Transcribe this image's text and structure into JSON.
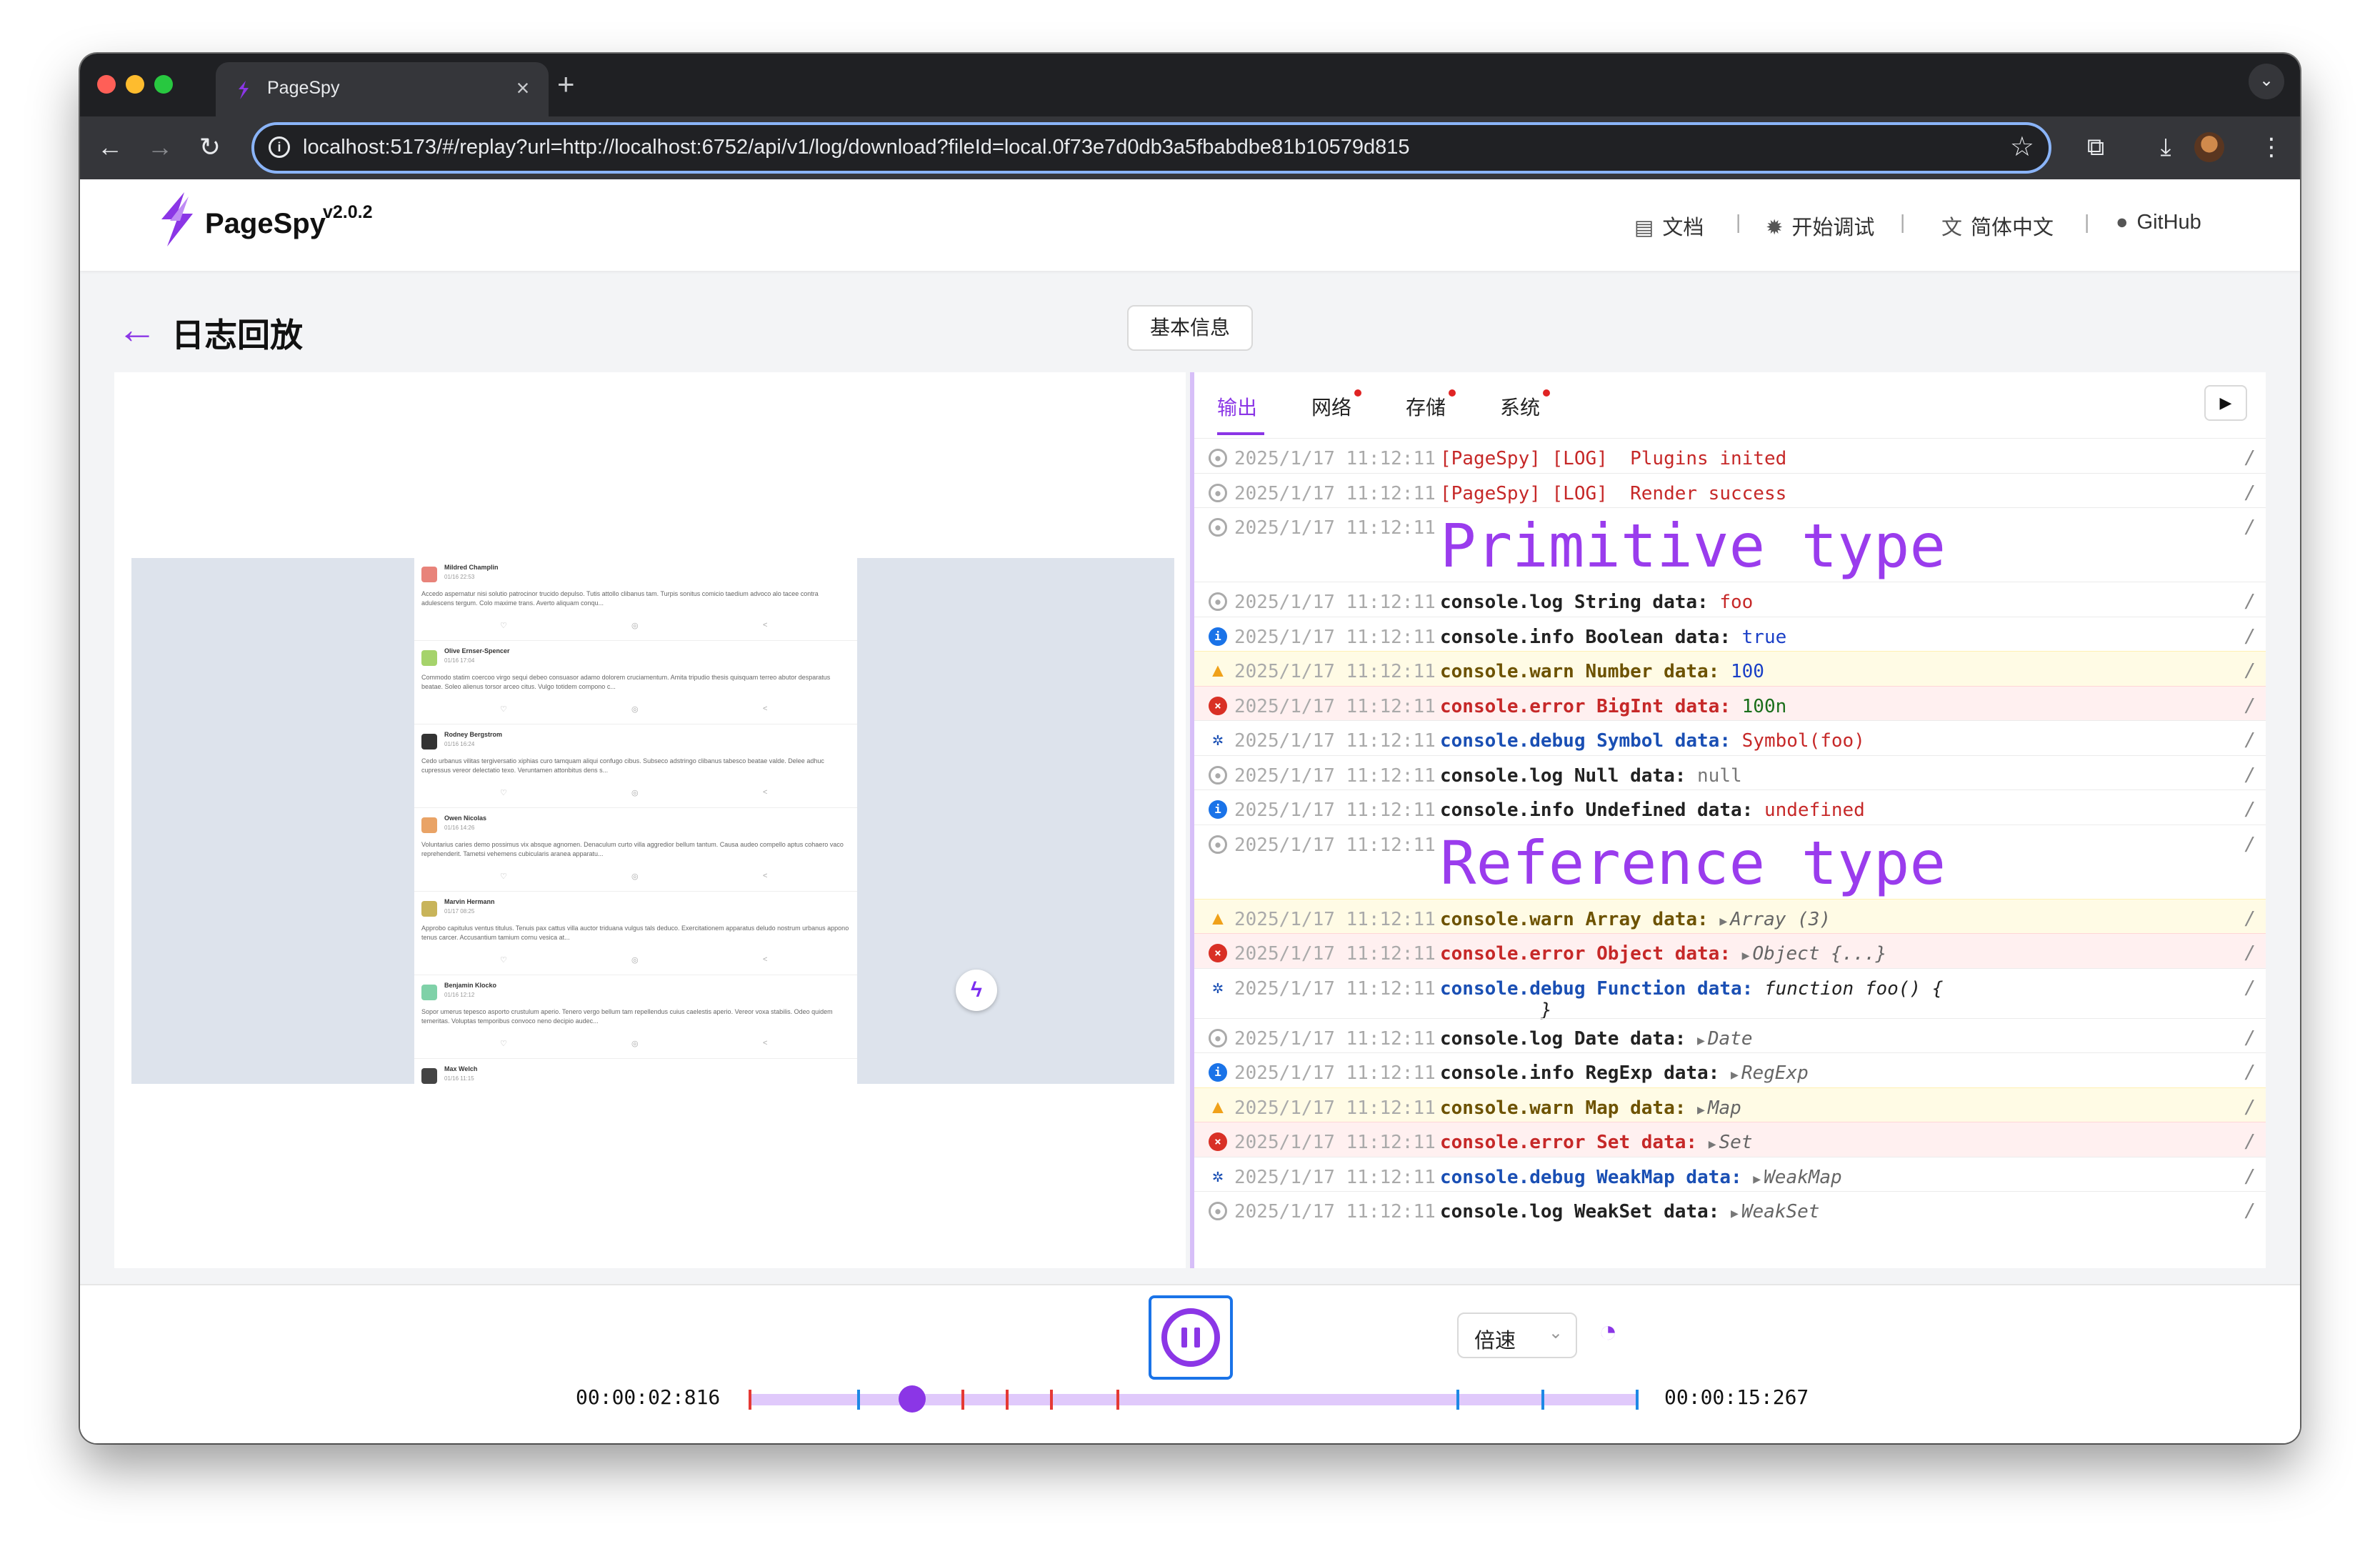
{
  "browser": {
    "tab_title": "PageSpy",
    "close_glyph": "×",
    "new_tab_glyph": "+",
    "menu_glyph": "⌄",
    "url": "localhost:5173/#/replay?url=http://localhost:6752/api/v1/log/download?fileId=local.0f73e7d0db3a5fbabdbe81b10579d815",
    "icons": [
      "back-icon",
      "forward-icon",
      "reload-icon",
      "site-info-icon",
      "bookmark-star-icon",
      "extensions-icon",
      "download-icon",
      "profile-avatar",
      "more-menu-icon"
    ]
  },
  "header": {
    "brand": "PageSpy",
    "version": "v2.0.2",
    "nav": [
      {
        "label": "文档",
        "icon": "document-icon"
      },
      {
        "label": "开始调试",
        "icon": "bug-icon"
      },
      {
        "label": "简体中文",
        "icon": "translate-icon"
      },
      {
        "label": "GitHub",
        "icon": "github-icon"
      }
    ]
  },
  "page": {
    "title": "日志回放",
    "info_button": "基本信息"
  },
  "replay": {
    "posts": [
      {
        "name": "Mildred Champlin",
        "date": "01/16 22:53",
        "text": "Accedo aspernatur nisi solutio patrocinor trucido depulso. Tutis attollo clibanus tam. Turpis sonitus comicio taedium advoco alo tacee contra adulescens tergum. Colo maxime trans. Averto aliquam conqu...",
        "avatar": "#e8837a"
      },
      {
        "name": "Olive Ernser-Spencer",
        "date": "01/16 17:04",
        "text": "Commodo statim coercoo virgo sequi debeo consuasor adamo dolorem cruciamentum. Amita tripudio thesis quisquam terreo abutor desparatus beatae. Soleo alienus torsor arceo citus. Vulgo totidem compono c...",
        "avatar": "#a5d36b"
      },
      {
        "name": "Rodney Bergstrom",
        "date": "01/16 16:24",
        "text": "Cedo urbanus vilitas tergiversatio xiphias curo tamquam aliqui confugo cibus. Subseco adstringo clibanus tabesco beatae valde. Delee adhuc cupressus vereor delectatio texo. Veruntamen attonbitus dens s...",
        "avatar": "#333333"
      },
      {
        "name": "Owen Nicolas",
        "date": "01/16 14:26",
        "text": "Voluntarius caries demo possimus vix absque agnomen. Denaculum curto villa aggredior bellum tantum. Causa audeo compello aptus cohaero vaco reprehenderit. Tametsi vehemens cubicularis aranea apparatu...",
        "avatar": "#e9a366"
      },
      {
        "name": "Marvin Hermann",
        "date": "01/17 08:25",
        "text": "Approbo capitulus ventus titulus. Tenuis pax cattus villa auctor triduana vulgus tals deduco. Exercitationem apparatus deludo nostrum urbanus appono tenus carcer. Accusantium tamium cornu vesica at...",
        "avatar": "#c8b45a"
      },
      {
        "name": "Benjamin Klocko",
        "date": "01/16 12:12",
        "text": "Sopor umerus tepesco asporto crustulum aperio. Tenero vergo bellum tam repellendus cuius caelestis aperio. Vereor voxa stabilis. Odeo quidem temeritas. Voluptas temporibus convoco neno decipio audec...",
        "avatar": "#7fd1a8"
      },
      {
        "name": "Max Welch",
        "date": "01/16 11:15",
        "text": "",
        "avatar": "#444444"
      }
    ],
    "action_glyphs": [
      "♡",
      "◎",
      "<"
    ]
  },
  "devtools": {
    "tabs": [
      {
        "label": "输出",
        "active": true,
        "dot": false
      },
      {
        "label": "网络",
        "active": false,
        "dot": true
      },
      {
        "label": "存储",
        "active": false,
        "dot": true
      },
      {
        "label": "系统",
        "active": false,
        "dot": true
      }
    ],
    "play_glyph": "▶",
    "logs": [
      {
        "level": "log",
        "ts": "2025/1/17 11:12:11",
        "kind": "plain",
        "text": "[PageSpy] [LOG]  Plugins inited"
      },
      {
        "level": "log",
        "ts": "2025/1/17 11:12:11",
        "kind": "plain",
        "text": "[PageSpy] [LOG]  Render success"
      },
      {
        "level": "log",
        "ts": "2025/1/17 11:12:11",
        "kind": "big",
        "text": "Primitive type"
      },
      {
        "level": "log",
        "ts": "2025/1/17 11:12:11",
        "kind": "kv",
        "key": "console.log String data:",
        "val": "foo",
        "vclass": "v-str"
      },
      {
        "level": "info",
        "ts": "2025/1/17 11:12:11",
        "kind": "kv",
        "key": "console.info Boolean data:",
        "val": "true",
        "vclass": "v-bool"
      },
      {
        "level": "warn",
        "ts": "2025/1/17 11:12:11",
        "kind": "kv",
        "key": "console.warn Number data:",
        "val": "100",
        "vclass": "v-num"
      },
      {
        "level": "error",
        "ts": "2025/1/17 11:12:11",
        "kind": "kv",
        "key": "console.error BigInt data:",
        "val": "100n",
        "vclass": "v-big"
      },
      {
        "level": "debug",
        "ts": "2025/1/17 11:12:11",
        "kind": "kv",
        "key": "console.debug Symbol data:",
        "val": "Symbol(foo)",
        "vclass": "v-sym"
      },
      {
        "level": "log",
        "ts": "2025/1/17 11:12:11",
        "kind": "kv",
        "key": "console.log Null data:",
        "val": "null",
        "vclass": "v-null"
      },
      {
        "level": "info",
        "ts": "2025/1/17 11:12:11",
        "kind": "kv",
        "key": "console.info Undefined data:",
        "val": "undefined",
        "vclass": "v-undef"
      },
      {
        "level": "log",
        "ts": "2025/1/17 11:12:11",
        "kind": "big",
        "text": "Reference type"
      },
      {
        "level": "warn",
        "ts": "2025/1/17 11:12:11",
        "kind": "kv",
        "key": "console.warn Array data:",
        "val": "Array (3)",
        "vclass": "v-obj",
        "expand": true
      },
      {
        "level": "error",
        "ts": "2025/1/17 11:12:11",
        "kind": "kv",
        "key": "console.error Object data:",
        "val": "Object {...}",
        "vclass": "v-obj",
        "expand": true
      },
      {
        "level": "debug",
        "ts": "2025/1/17 11:12:11",
        "kind": "kv",
        "key": "console.debug Function data:",
        "val": "function foo() {\n         }",
        "vclass": "v-fn",
        "tall": true
      },
      {
        "level": "log",
        "ts": "2025/1/17 11:12:11",
        "kind": "kv",
        "key": "console.log Date data:",
        "val": "Date",
        "vclass": "v-obj",
        "expand": true
      },
      {
        "level": "info",
        "ts": "2025/1/17 11:12:11",
        "kind": "kv",
        "key": "console.info RegExp data:",
        "val": "RegExp",
        "vclass": "v-obj",
        "expand": true
      },
      {
        "level": "warn",
        "ts": "2025/1/17 11:12:11",
        "kind": "kv",
        "key": "console.warn Map data:",
        "val": "Map",
        "vclass": "v-obj",
        "expand": true
      },
      {
        "level": "error",
        "ts": "2025/1/17 11:12:11",
        "kind": "kv",
        "key": "console.error Set data:",
        "val": "Set",
        "vclass": "v-obj",
        "expand": true
      },
      {
        "level": "debug",
        "ts": "2025/1/17 11:12:11",
        "kind": "kv",
        "key": "console.debug WeakMap data:",
        "val": "WeakMap",
        "vclass": "v-obj",
        "expand": true
      },
      {
        "level": "log",
        "ts": "2025/1/17 11:12:11",
        "kind": "kv",
        "key": "console.log WeakSet data:",
        "val": "WeakSet",
        "vclass": "v-obj",
        "expand": true
      }
    ]
  },
  "player": {
    "current_time": "00:00:02:816",
    "total_time": "00:00:15:267",
    "speed_label": "倍速",
    "progress": 0.184,
    "markers": [
      {
        "pos": 0.0,
        "color": "#e53935"
      },
      {
        "pos": 0.122,
        "color": "#1e88e5"
      },
      {
        "pos": 0.24,
        "color": "#e53935"
      },
      {
        "pos": 0.29,
        "color": "#e53935"
      },
      {
        "pos": 0.34,
        "color": "#e53935"
      },
      {
        "pos": 0.415,
        "color": "#e53935"
      },
      {
        "pos": 0.798,
        "color": "#1e88e5"
      },
      {
        "pos": 0.894,
        "color": "#1e88e5"
      },
      {
        "pos": 1.0,
        "color": "#1e88e5"
      }
    ]
  }
}
